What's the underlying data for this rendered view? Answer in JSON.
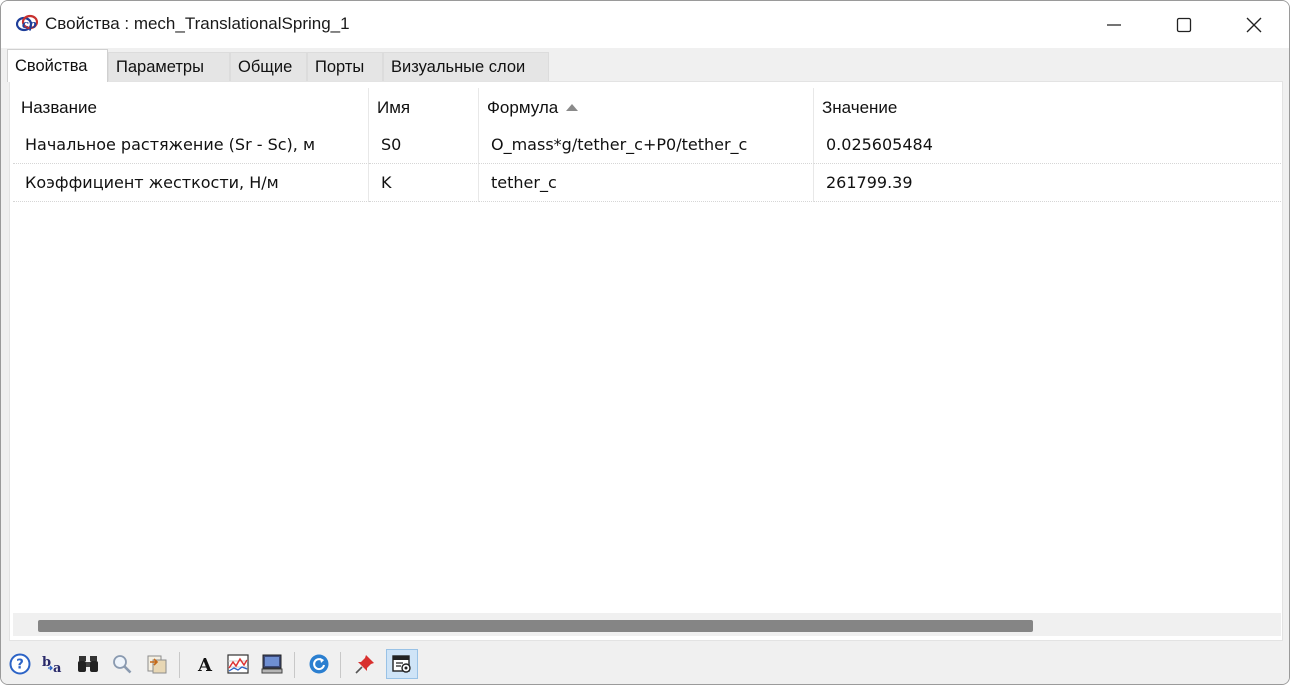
{
  "window": {
    "title": "Свойства : mech_TranslationalSpring_1",
    "minimize_icon": "minimize-icon",
    "maximize_icon": "maximize-icon",
    "close_icon": "close-icon"
  },
  "tabs": [
    {
      "label": "Свойства",
      "active": true
    },
    {
      "label": "Параметры",
      "active": false
    },
    {
      "label": "Общие",
      "active": false
    },
    {
      "label": "Порты",
      "active": false
    },
    {
      "label": "Визуальные слои",
      "active": false
    }
  ],
  "table": {
    "columns": [
      "Название",
      "Имя",
      "Формула",
      "Значение"
    ],
    "sorted_column": "Формула",
    "sort_direction": "ascending",
    "rows": [
      {
        "name": "Начальное растяжение (Sr - Sc), м",
        "id": "S0",
        "formula": "O_mass*g/tether_c+P0/tether_c",
        "value": "0.025605484"
      },
      {
        "name": "Коэффициент жесткости, Н/м",
        "id": "K",
        "formula": "tether_c",
        "value": "261799.39"
      }
    ]
  },
  "toolbar": {
    "buttons": [
      {
        "name": "help-icon",
        "label_glyph": "?"
      },
      {
        "name": "rename-icon",
        "label_glyph": "b a"
      },
      {
        "name": "binoculars-icon",
        "label_glyph": ""
      },
      {
        "name": "magnifier-icon",
        "label_glyph": ""
      },
      {
        "name": "import-icon",
        "label_glyph": ""
      },
      {
        "name": "font-icon",
        "label_glyph": "A"
      },
      {
        "name": "chart-icon",
        "label_glyph": ""
      },
      {
        "name": "monitor-icon",
        "label_glyph": ""
      },
      {
        "name": "refresh-icon",
        "label_glyph": ""
      },
      {
        "name": "pin-icon",
        "label_glyph": ""
      },
      {
        "name": "view-icon",
        "label_glyph": ""
      }
    ]
  },
  "colors": {
    "accent_blue": "#2b63c6",
    "scroll_thumb": "#858585",
    "pressed_bg": "#cfe4f7"
  }
}
